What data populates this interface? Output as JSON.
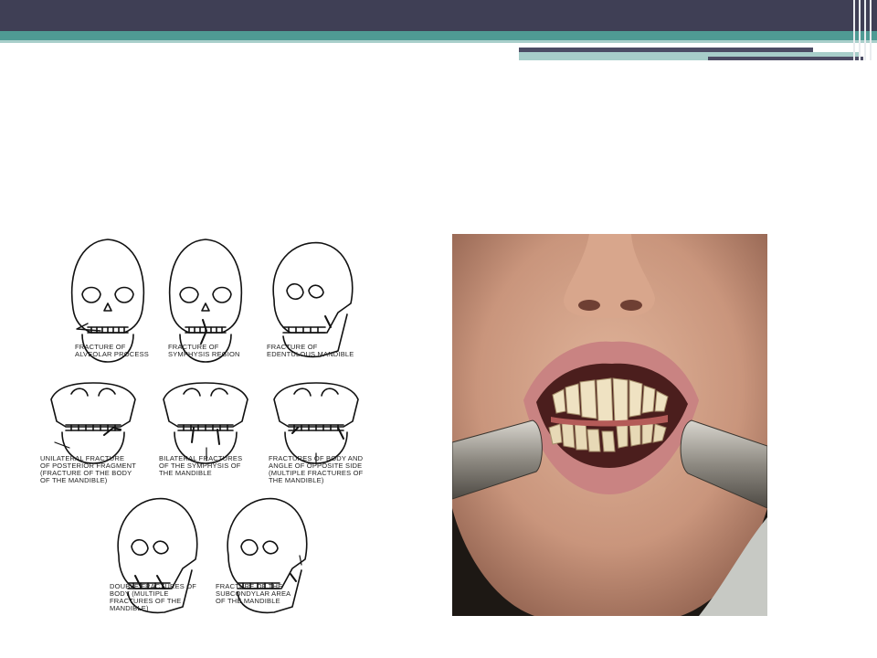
{
  "diagram": {
    "labels": [
      "FRACTURE OF\nALVEOLAR PROCESS",
      "FRACTURE OF\nSYMPHYSIS REGION",
      "FRACTURE OF\nEDENTULOUS MANDIBLE",
      "UNILATERAL FRACTURE\nOF POSTERIOR FRAGMENT\n(FRACTURE OF THE BODY\nOF THE MANDIBLE)",
      "BILATERAL FRACTURES\nOF THE SYMPHYSIS OF\nTHE MANDIBLE",
      "FRACTURES OF BODY AND\nANGLE OF OPPOSITE SIDE\n(MULTIPLE FRACTURES OF\nTHE MANDIBLE)",
      "DOUBLE FRACTURES OF\nBODY (MULTIPLE\nFRACTURES OF THE\nMANDIBLE)",
      "FRACTURE OF THE\nSUBCONDYLAR AREA\nOF THE MANDIBLE"
    ]
  },
  "colors": {
    "header_dark": "#3f3f55",
    "header_teal": "#4f9a94",
    "header_light": "#a9cfcb"
  }
}
